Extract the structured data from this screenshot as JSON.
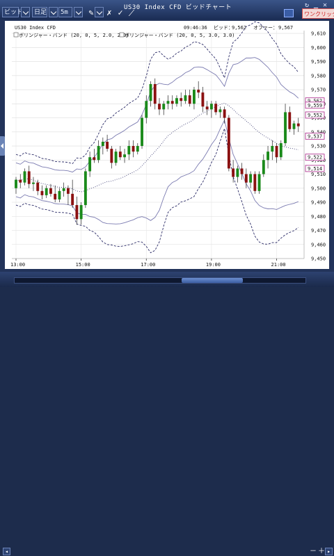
{
  "toolbar": {
    "items": [
      "ビッド",
      "日足",
      "5m"
    ],
    "title": "US30 Index CFD ビッドチャート",
    "badge": "ワンクリック"
  },
  "info": {
    "time": "09:46:36",
    "bid_label": "ビッド：",
    "bid": "9,562",
    "offer_label": "オファー：",
    "offer": "9,567",
    "title": "US30 Index CFD"
  },
  "legend": {
    "bb1": "ボリンジャー・バンド (20, 0, 5, 2.0, 2.0)",
    "bb2": "ボリンジャー・バンド (20, 0, 5, 3.0, 3.0)"
  },
  "bottom": {
    "zoom_in": "＋",
    "zoom_out": "－",
    "corner": "9.2"
  },
  "colors": {
    "background": "#ffffff",
    "bull": "#1a8a1a",
    "bear": "#8b1111",
    "band_dotted": "#2a2a66",
    "band_solid": "#7a7ab0",
    "price_tag": "#aa2288",
    "frame": "#22335a"
  },
  "chart_data": {
    "type": "candlestick",
    "ylim": [
      9450,
      9612
    ],
    "y_ticks": [
      9610,
      9600,
      9590,
      9580,
      9570,
      9560,
      9550,
      9540,
      9530,
      9520,
      9510,
      9500,
      9490,
      9480,
      9470,
      9460,
      9450
    ],
    "x_ticks": [
      "13:00",
      "15:00",
      "17:00",
      "19:00",
      "21:00"
    ],
    "price_tags": [
      "9,562",
      "9,559",
      "9,552",
      "9,537",
      "9,522",
      "9,514"
    ],
    "candles": [
      {
        "o": 9500,
        "h": 9508,
        "l": 9496,
        "c": 9506
      },
      {
        "o": 9506,
        "h": 9510,
        "l": 9500,
        "c": 9504
      },
      {
        "o": 9504,
        "h": 9514,
        "l": 9502,
        "c": 9512
      },
      {
        "o": 9512,
        "h": 9516,
        "l": 9500,
        "c": 9503
      },
      {
        "o": 9503,
        "h": 9508,
        "l": 9498,
        "c": 9504
      },
      {
        "o": 9504,
        "h": 9506,
        "l": 9495,
        "c": 9498
      },
      {
        "o": 9498,
        "h": 9502,
        "l": 9492,
        "c": 9495
      },
      {
        "o": 9495,
        "h": 9502,
        "l": 9493,
        "c": 9500
      },
      {
        "o": 9500,
        "h": 9503,
        "l": 9494,
        "c": 9496
      },
      {
        "o": 9496,
        "h": 9502,
        "l": 9490,
        "c": 9492
      },
      {
        "o": 9492,
        "h": 9500,
        "l": 9490,
        "c": 9498
      },
      {
        "o": 9498,
        "h": 9504,
        "l": 9494,
        "c": 9500
      },
      {
        "o": 9500,
        "h": 9502,
        "l": 9488,
        "c": 9496
      },
      {
        "o": 9496,
        "h": 9506,
        "l": 9486,
        "c": 9488
      },
      {
        "o": 9488,
        "h": 9494,
        "l": 9474,
        "c": 9478
      },
      {
        "o": 9478,
        "h": 9490,
        "l": 9474,
        "c": 9488
      },
      {
        "o": 9488,
        "h": 9514,
        "l": 9486,
        "c": 9512
      },
      {
        "o": 9512,
        "h": 9526,
        "l": 9508,
        "c": 9522
      },
      {
        "o": 9522,
        "h": 9528,
        "l": 9518,
        "c": 9520
      },
      {
        "o": 9520,
        "h": 9534,
        "l": 9518,
        "c": 9530
      },
      {
        "o": 9530,
        "h": 9536,
        "l": 9524,
        "c": 9533
      },
      {
        "o": 9533,
        "h": 9538,
        "l": 9526,
        "c": 9528
      },
      {
        "o": 9528,
        "h": 9530,
        "l": 9514,
        "c": 9518
      },
      {
        "o": 9518,
        "h": 9528,
        "l": 9516,
        "c": 9526
      },
      {
        "o": 9526,
        "h": 9530,
        "l": 9520,
        "c": 9522
      },
      {
        "o": 9522,
        "h": 9528,
        "l": 9518,
        "c": 9524
      },
      {
        "o": 9524,
        "h": 9534,
        "l": 9520,
        "c": 9530
      },
      {
        "o": 9530,
        "h": 9534,
        "l": 9522,
        "c": 9526
      },
      {
        "o": 9526,
        "h": 9532,
        "l": 9524,
        "c": 9530
      },
      {
        "o": 9530,
        "h": 9552,
        "l": 9528,
        "c": 9550
      },
      {
        "o": 9550,
        "h": 9566,
        "l": 9546,
        "c": 9562
      },
      {
        "o": 9562,
        "h": 9576,
        "l": 9558,
        "c": 9574
      },
      {
        "o": 9574,
        "h": 9578,
        "l": 9556,
        "c": 9560
      },
      {
        "o": 9560,
        "h": 9564,
        "l": 9552,
        "c": 9556
      },
      {
        "o": 9556,
        "h": 9562,
        "l": 9552,
        "c": 9560
      },
      {
        "o": 9560,
        "h": 9566,
        "l": 9556,
        "c": 9562
      },
      {
        "o": 9562,
        "h": 9566,
        "l": 9556,
        "c": 9560
      },
      {
        "o": 9560,
        "h": 9566,
        "l": 9558,
        "c": 9564
      },
      {
        "o": 9564,
        "h": 9568,
        "l": 9558,
        "c": 9562
      },
      {
        "o": 9562,
        "h": 9570,
        "l": 9560,
        "c": 9566
      },
      {
        "o": 9566,
        "h": 9570,
        "l": 9558,
        "c": 9560
      },
      {
        "o": 9560,
        "h": 9572,
        "l": 9556,
        "c": 9570
      },
      {
        "o": 9570,
        "h": 9576,
        "l": 9564,
        "c": 9568
      },
      {
        "o": 9568,
        "h": 9572,
        "l": 9554,
        "c": 9558
      },
      {
        "o": 9558,
        "h": 9562,
        "l": 9552,
        "c": 9556
      },
      {
        "o": 9556,
        "h": 9562,
        "l": 9550,
        "c": 9560
      },
      {
        "o": 9560,
        "h": 9562,
        "l": 9552,
        "c": 9554
      },
      {
        "o": 9554,
        "h": 9558,
        "l": 9550,
        "c": 9556
      },
      {
        "o": 9556,
        "h": 9558,
        "l": 9546,
        "c": 9550
      },
      {
        "o": 9550,
        "h": 9552,
        "l": 9512,
        "c": 9514
      },
      {
        "o": 9514,
        "h": 9520,
        "l": 9504,
        "c": 9508
      },
      {
        "o": 9508,
        "h": 9516,
        "l": 9504,
        "c": 9514
      },
      {
        "o": 9514,
        "h": 9518,
        "l": 9506,
        "c": 9510
      },
      {
        "o": 9510,
        "h": 9514,
        "l": 9500,
        "c": 9504
      },
      {
        "o": 9504,
        "h": 9512,
        "l": 9500,
        "c": 9510
      },
      {
        "o": 9510,
        "h": 9512,
        "l": 9496,
        "c": 9498
      },
      {
        "o": 9498,
        "h": 9512,
        "l": 9496,
        "c": 9510
      },
      {
        "o": 9510,
        "h": 9524,
        "l": 9508,
        "c": 9520
      },
      {
        "o": 9520,
        "h": 9530,
        "l": 9514,
        "c": 9526
      },
      {
        "o": 9526,
        "h": 9534,
        "l": 9520,
        "c": 9530
      },
      {
        "o": 9530,
        "h": 9532,
        "l": 9518,
        "c": 9522
      },
      {
        "o": 9522,
        "h": 9534,
        "l": 9520,
        "c": 9532
      },
      {
        "o": 9532,
        "h": 9560,
        "l": 9530,
        "c": 9554
      },
      {
        "o": 9554,
        "h": 9558,
        "l": 9540,
        "c": 9542
      },
      {
        "o": 9542,
        "h": 9548,
        "l": 9538,
        "c": 9546
      },
      {
        "o": 9546,
        "h": 9550,
        "l": 9540,
        "c": 9544
      }
    ]
  }
}
